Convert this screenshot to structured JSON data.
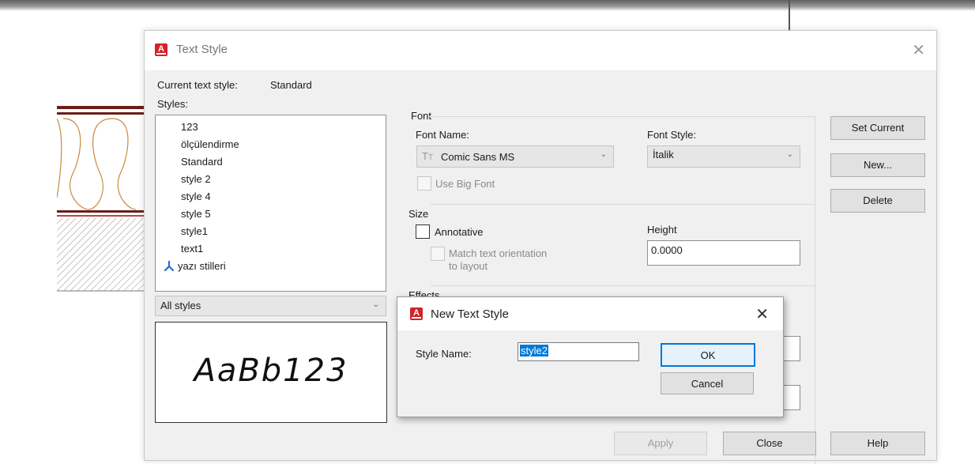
{
  "dialog": {
    "title": "Text Style",
    "current_label": "Current text style:",
    "current_value": "Standard",
    "styles_label": "Styles:"
  },
  "styles": [
    {
      "label": "123"
    },
    {
      "label": "ölçülendirme"
    },
    {
      "label": "Standard"
    },
    {
      "label": "style 2"
    },
    {
      "label": "style 4"
    },
    {
      "label": "style 5"
    },
    {
      "label": "style1"
    },
    {
      "label": "text1"
    },
    {
      "label": "yazı stilleri",
      "icon": "annotative-icon"
    }
  ],
  "filter": {
    "value": "All styles"
  },
  "preview": {
    "text": "AaBb123"
  },
  "font": {
    "group_label": "Font",
    "name_label": "Font Name:",
    "name_value": "Comic Sans MS",
    "style_label": "Font Style:",
    "style_value": "İtalik",
    "big_font_label": "Use Big Font"
  },
  "size": {
    "group_label": "Size",
    "annotative_label": "Annotative",
    "match_label_1": "Match text orientation",
    "match_label_2": "to layout",
    "height_label": "Height",
    "height_value": "0.0000"
  },
  "effects": {
    "group_label": "Effects"
  },
  "buttons": {
    "set_current": "Set Current",
    "new": "New...",
    "delete": "Delete",
    "apply": "Apply",
    "close": "Close",
    "help": "Help"
  },
  "new_dialog": {
    "title": "New Text Style",
    "style_name_label": "Style Name:",
    "style_name_value": "style2",
    "ok": "OK",
    "cancel": "Cancel"
  },
  "colors": {
    "accent": "#0078d7",
    "app_icon": "#d2232a"
  }
}
